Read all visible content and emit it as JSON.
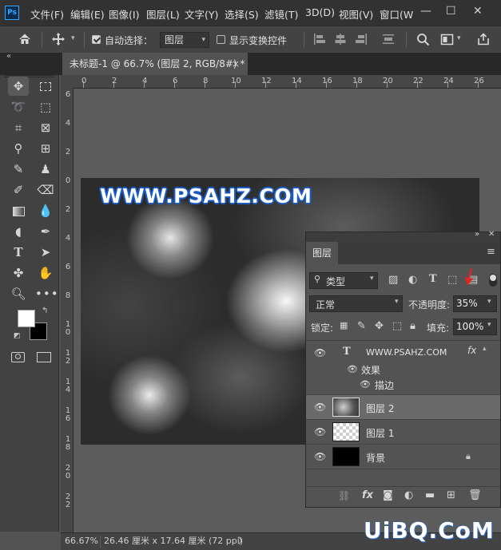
{
  "app": {
    "logo_text": "Ps"
  },
  "menu": {
    "items": [
      "文件(F)",
      "编辑(E)",
      "图像(I)",
      "图层(L)",
      "文字(Y)",
      "选择(S)",
      "滤镜(T)",
      "3D(D)",
      "视图(V)",
      "窗口(W"
    ],
    "window_controls": {
      "minimize": "—",
      "maximize": "☐",
      "close": "✕"
    }
  },
  "options_bar": {
    "auto_select_label": "自动选择：",
    "auto_select_checked": true,
    "auto_select_target": "图层",
    "show_transform_label": "显示变换控件",
    "show_transform_checked": false
  },
  "document_tab": {
    "title": "未标题-1 @ 66.7% (图层 2, RGB/8#) *",
    "close": "×"
  },
  "ruler": {
    "top_ticks": [
      "0",
      "2",
      "4",
      "6",
      "8",
      "10",
      "12",
      "14",
      "16",
      "18",
      "20",
      "22",
      "24",
      "26"
    ],
    "left_ticks": [
      "6",
      "4",
      "2",
      "0",
      "2",
      "4",
      "6",
      "8",
      "10",
      "12",
      "14",
      "16",
      "18",
      "20",
      "22"
    ]
  },
  "canvas": {
    "text": "WWW.PSAHZ.COM"
  },
  "status_bar": {
    "zoom": "66.67%",
    "doc_size": "26.46 厘米 x 17.64 厘米 (72 ppi)",
    "arrow": "〉"
  },
  "layers_panel": {
    "tab_label": "图层",
    "filter_type": "类型",
    "blend_mode": "正常",
    "opacity_label": "不透明度:",
    "opacity_value": "35%",
    "lock_label": "锁定:",
    "fill_label": "填充:",
    "fill_value": "100%",
    "layers": [
      {
        "name": "WWW.PSAHZ.COM",
        "type": "text",
        "fx": "fx",
        "effects_label": "效果",
        "stroke_label": "描边"
      },
      {
        "name": "图层 2",
        "type": "pixel",
        "selected": true
      },
      {
        "name": "图层 1",
        "type": "transparent"
      },
      {
        "name": "背景",
        "type": "background",
        "locked": true
      }
    ]
  },
  "watermark": {
    "text": "UiBQ.CoM"
  }
}
